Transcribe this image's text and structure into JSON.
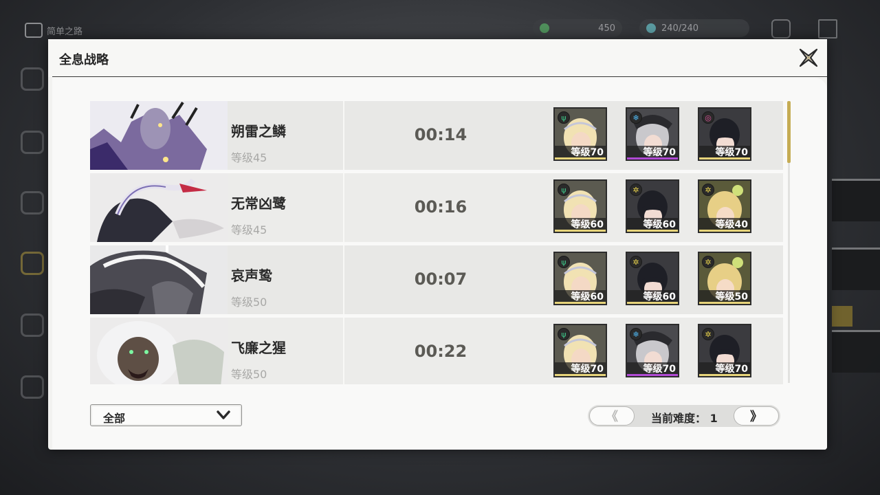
{
  "background": {
    "title": "简单之路",
    "currencies": [
      {
        "icon": "stamina-icon",
        "value": "450"
      },
      {
        "icon": "crystal-icon",
        "value": "240/240"
      }
    ]
  },
  "dialog": {
    "title": "全息战略",
    "close_label": "关闭"
  },
  "records": [
    {
      "boss_name": "朔雷之鳞",
      "boss_level": "等级45",
      "clear_time": "00:14",
      "team": [
        {
          "level": "等级70",
          "element": "aero",
          "element_color": "#3fc98a",
          "rarity_color": "#e7d47a",
          "hair_color": "#f1e2b3"
        },
        {
          "level": "等级70",
          "element": "glacio",
          "element_color": "#4fb6f0",
          "rarity_color": "#b04ad4",
          "hair_color": "#c9c8cc"
        },
        {
          "level": "等级70",
          "element": "havoc",
          "element_color": "#e0539b",
          "rarity_color": "#e7d47a",
          "hair_color": "#1e1f26"
        }
      ]
    },
    {
      "boss_name": "无常凶鹭",
      "boss_level": "等级45",
      "clear_time": "00:16",
      "team": [
        {
          "level": "等级60",
          "element": "aero",
          "element_color": "#3fc98a",
          "rarity_color": "#e7d47a",
          "hair_color": "#f1e2b3"
        },
        {
          "level": "等级60",
          "element": "spectro",
          "element_color": "#e8d24c",
          "rarity_color": "#e7d47a",
          "hair_color": "#1e1f26"
        },
        {
          "level": "等级40",
          "element": "spectro",
          "element_color": "#e8d24c",
          "rarity_color": "#e7d47a",
          "hair_color": "#e7cf86"
        }
      ]
    },
    {
      "boss_name": "哀声鸷",
      "boss_level": "等级50",
      "clear_time": "00:07",
      "team": [
        {
          "level": "等级60",
          "element": "aero",
          "element_color": "#3fc98a",
          "rarity_color": "#e7d47a",
          "hair_color": "#f1e2b3"
        },
        {
          "level": "等级60",
          "element": "spectro",
          "element_color": "#e8d24c",
          "rarity_color": "#e7d47a",
          "hair_color": "#1e1f26"
        },
        {
          "level": "等级50",
          "element": "spectro",
          "element_color": "#e8d24c",
          "rarity_color": "#e7d47a",
          "hair_color": "#e7cf86"
        }
      ]
    },
    {
      "boss_name": "飞廉之猩",
      "boss_level": "等级50",
      "clear_time": "00:22",
      "team": [
        {
          "level": "等级70",
          "element": "aero",
          "element_color": "#3fc98a",
          "rarity_color": "#e7d47a",
          "hair_color": "#f1e2b3"
        },
        {
          "level": "等级70",
          "element": "glacio",
          "element_color": "#4fb6f0",
          "rarity_color": "#b04ad4",
          "hair_color": "#c9c8cc"
        },
        {
          "level": "等级70",
          "element": "spectro",
          "element_color": "#e8d24c",
          "rarity_color": "#e7d47a",
          "hair_color": "#1e1f26"
        }
      ]
    }
  ],
  "filter": {
    "selected": "全部",
    "icon": "chevron-down-icon"
  },
  "pager": {
    "prev_label": "《",
    "next_label": "》",
    "difficulty_label": "当前难度：",
    "difficulty_value": "1"
  }
}
